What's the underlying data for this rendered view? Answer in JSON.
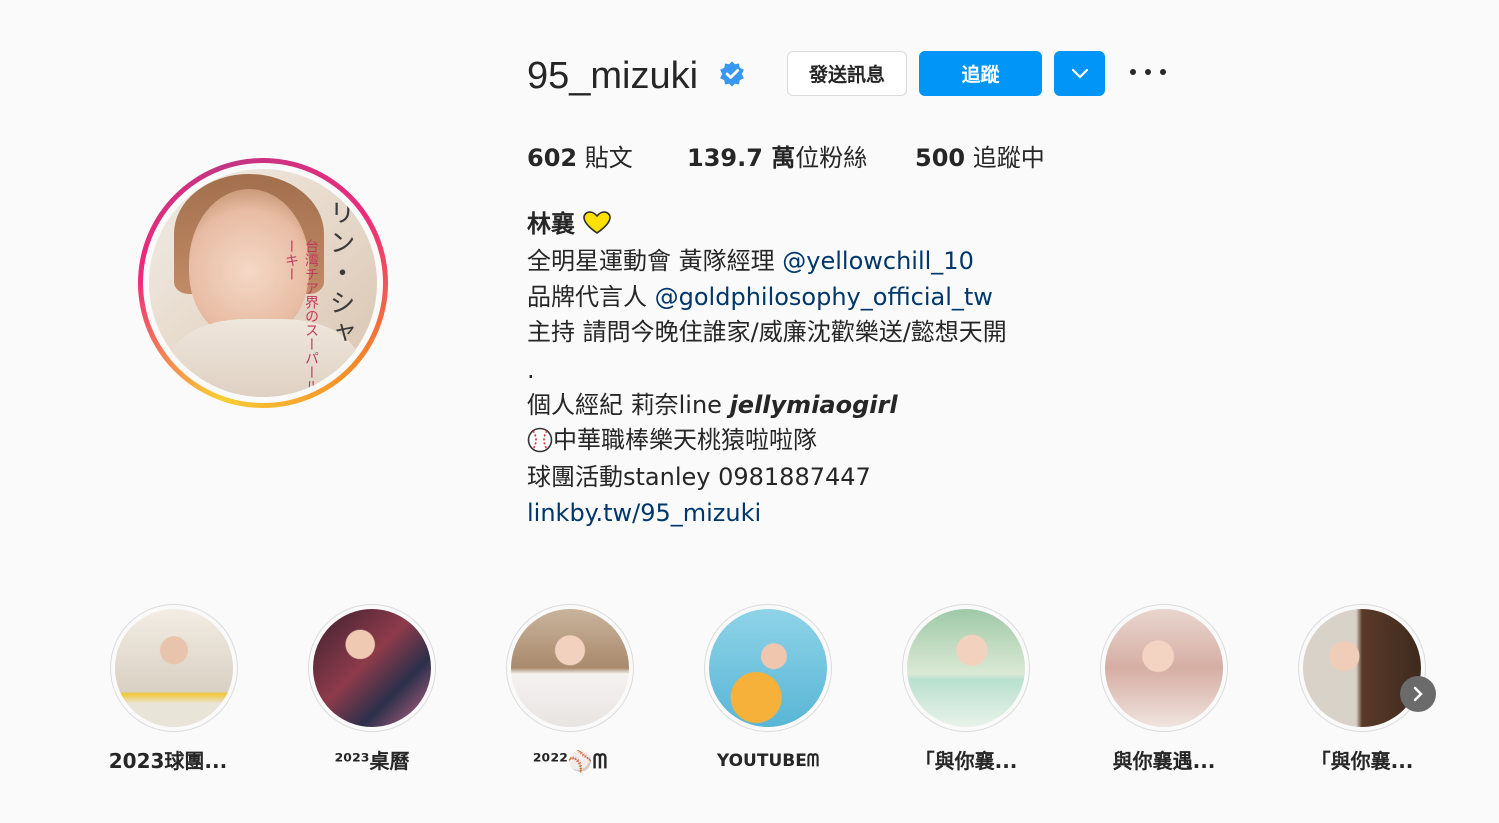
{
  "profile": {
    "username": "95_mizuki",
    "buttons": {
      "message": "發送訊息",
      "follow": "追蹤"
    },
    "stats": {
      "posts_value": "602",
      "posts_label": " 貼文",
      "followers_value": "139.7 萬",
      "followers_label": "位粉絲",
      "following_value": "500",
      "following_label": " 追蹤中"
    },
    "bio": {
      "name": "林襄",
      "line1": "全明星運動會 黃隊經理 ",
      "line1_link": "@yellowchill_10",
      "line2": "品牌代言人 ",
      "line2_link": "@goldphilosophy_official_tw",
      "line3": "主持 請問今晚住誰家/威廉沈歡樂送/懿想天開",
      "line4": ".",
      "line5": "個人經紀 莉奈line ",
      "line5_italic": "jellymiaogirl",
      "line6": "中華職棒樂天桃猿啦啦隊",
      "line7": "球團活動stanley 0981887447",
      "website": "linkby.tw/95_mizuki"
    },
    "avatar_text": {
      "main": "リン・シャ",
      "sub": "台湾チア界のスーパールーキー"
    }
  },
  "highlights": [
    {
      "label": "2023球團..."
    },
    {
      "label": "²⁰²³桌曆"
    },
    {
      "label": "²⁰²²⚾ᗰ"
    },
    {
      "label": "YOUTUBEᗰ"
    },
    {
      "label": "「與你襄..."
    },
    {
      "label": "與你襄遇..."
    },
    {
      "label": "「與你襄..."
    }
  ],
  "colors": {
    "accent": "#0095f6",
    "link": "#00376b",
    "verified": "#3897f0"
  }
}
